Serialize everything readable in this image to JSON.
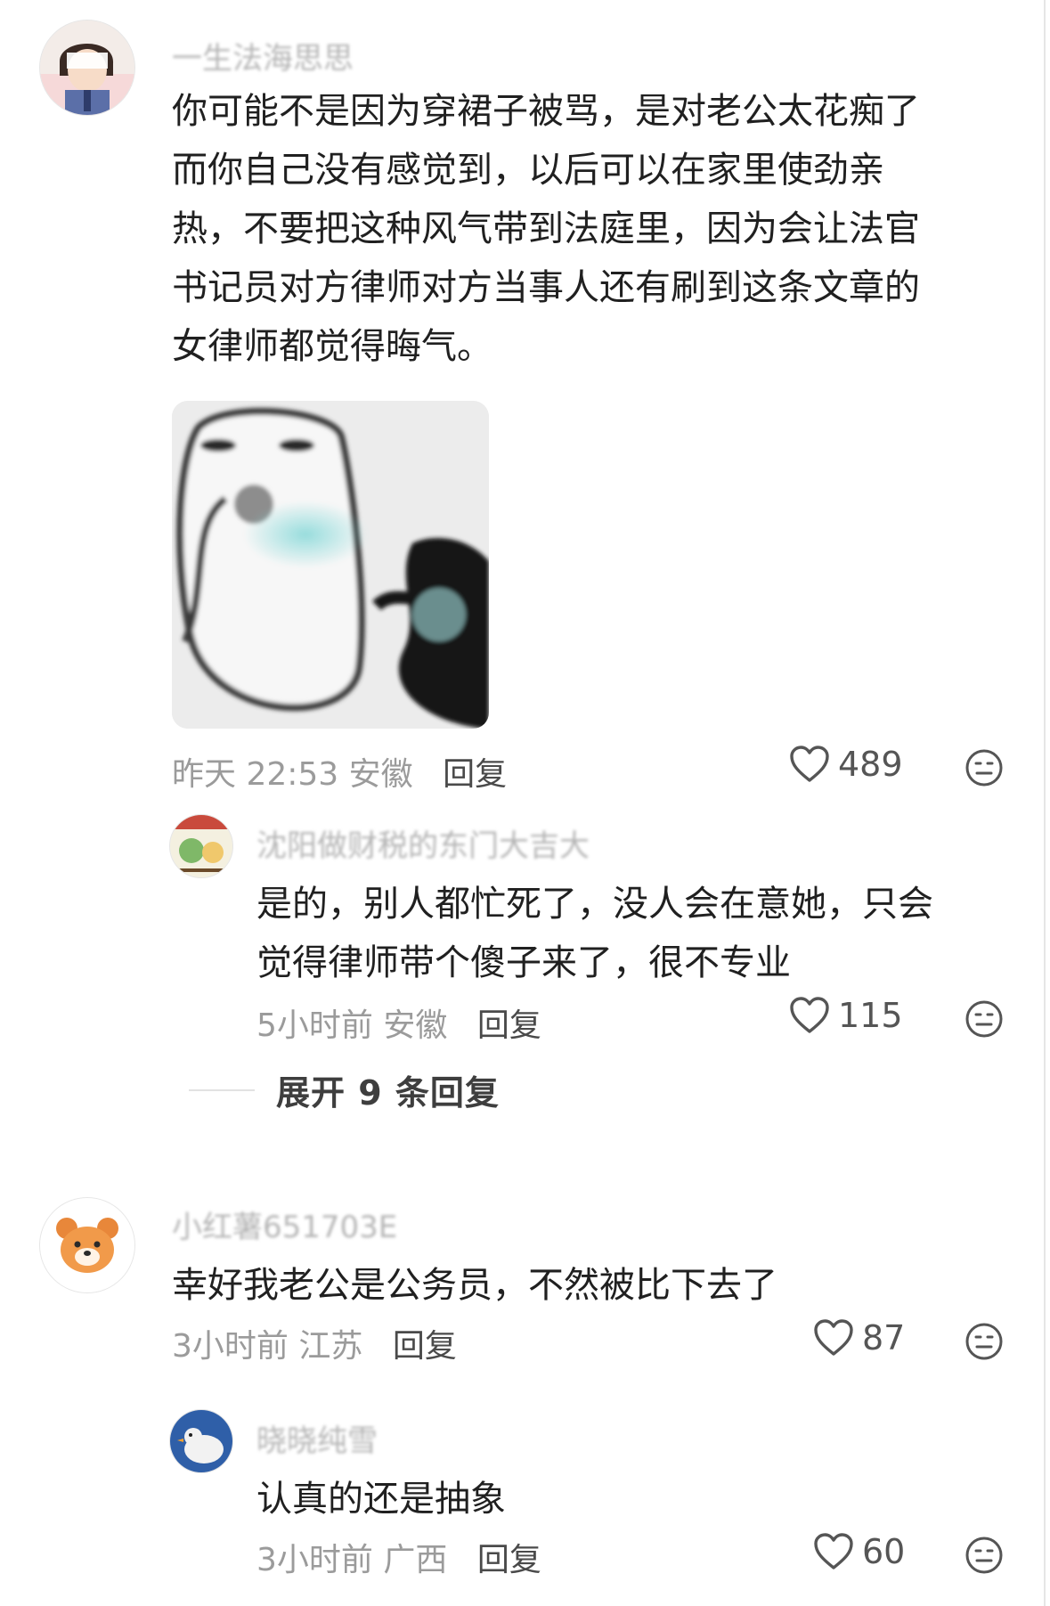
{
  "comments": [
    {
      "username": "一生法海思思",
      "text": "你可能不是因为穿裙子被骂，是对老公太花痴了\n而你自己没有感觉到，以后可以在家里使劲亲\n热，不要把这种风气带到法庭里，因为会让法官\n书记员对方律师对方当事人还有刷到这条文章的\n女律师都觉得晦气。",
      "time": "昨天 22:53",
      "location": "安徽",
      "reply_label": "回复",
      "likes": "489",
      "icons": [
        "heart-icon",
        "emoji-icon"
      ],
      "image": "meme-image"
    },
    {
      "username": "沈阳做财税的东门大吉大",
      "text": "是的，别人都忙死了，没人会在意她，只会\n觉得律师带个傻子来了，很不专业",
      "time": "5小时前",
      "location": "安徽",
      "reply_label": "回复",
      "likes": "115",
      "is_reply": true
    },
    {
      "username": "小红薯651703E",
      "text": "幸好我老公是公务员，不然被比下去了",
      "time": "3小时前",
      "location": "江苏",
      "reply_label": "回复",
      "likes": "87"
    },
    {
      "username": "晓晓纯雪",
      "text": "认真的还是抽象",
      "time": "3小时前",
      "location": "广西",
      "reply_label": "回复",
      "likes": "60",
      "is_reply": true
    }
  ],
  "expand_replies": "展开 9 条回复",
  "colors": {
    "text": "#202020",
    "meta": "#9b9b9b",
    "reply": "#4a4a4a",
    "divider": "#e2e2e2"
  }
}
